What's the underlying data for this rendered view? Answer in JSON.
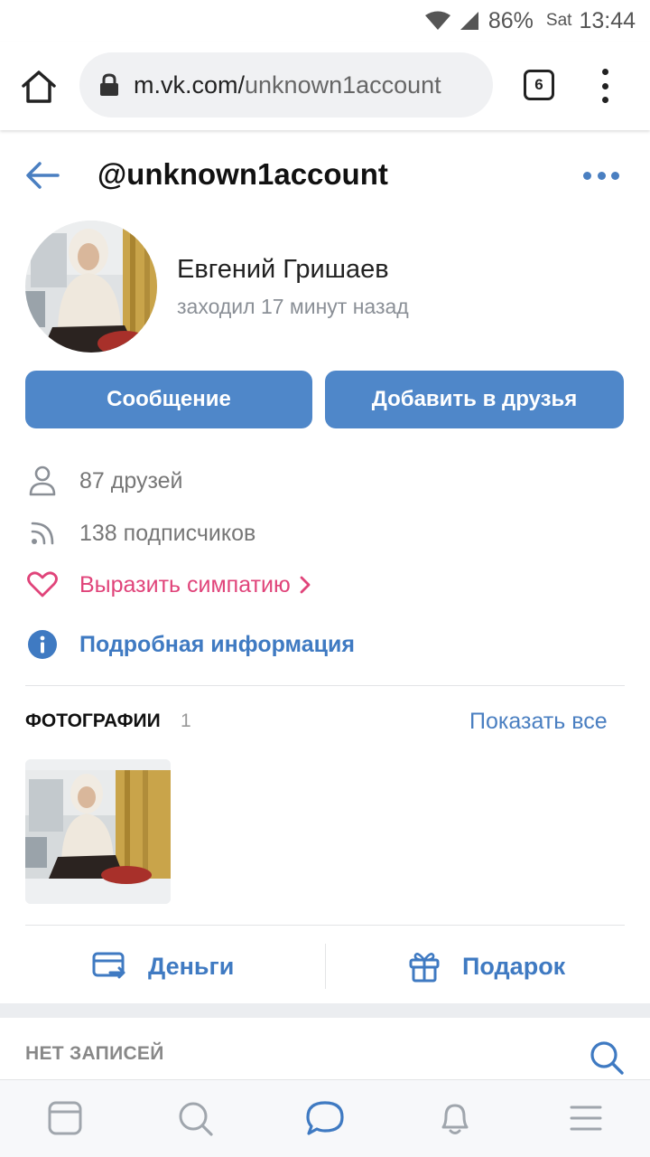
{
  "status_bar": {
    "battery": "86%",
    "day": "Sat",
    "time": "13:44"
  },
  "browser": {
    "url_host": "m.vk.com/",
    "url_path": "unknown1account",
    "tab_count": "6"
  },
  "header": {
    "title": "@unknown1account"
  },
  "profile": {
    "name": "Евгений Гришаев",
    "last_seen": "заходил 17 минут назад"
  },
  "buttons": {
    "message": "Сообщение",
    "add_friend": "Добавить в друзья"
  },
  "info": {
    "friends": "87 друзей",
    "subscribers": "138 подписчиков",
    "sympathy": "Выразить симпатию",
    "details": "Подробная информация"
  },
  "photos": {
    "title": "ФОТОГРАФИИ",
    "count": "1",
    "show_all": "Показать все"
  },
  "actions": {
    "money": "Деньги",
    "gift": "Подарок"
  },
  "posts": {
    "empty": "НЕТ ЗАПИСЕЙ"
  },
  "colors": {
    "accent": "#4f87c9",
    "link": "#3f7ac2",
    "pink": "#e0447a"
  },
  "icons": [
    "home-icon",
    "lock-icon",
    "back-arrow-icon",
    "more-icon",
    "user-icon",
    "rss-icon",
    "heart-icon",
    "info-icon",
    "money-transfer-icon",
    "gift-icon",
    "search-icon",
    "feed-icon",
    "messages-icon",
    "bell-icon",
    "menu-icon"
  ]
}
